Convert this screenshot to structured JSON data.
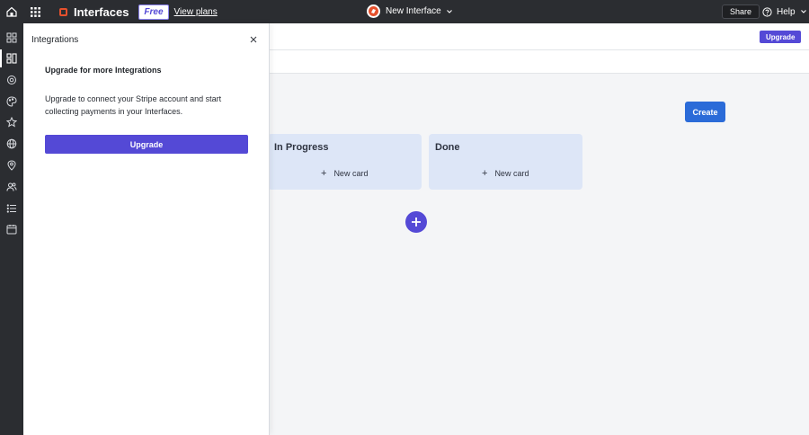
{
  "topbar": {
    "app_name": "Interfaces",
    "badge": "Free",
    "view_plans": "View plans",
    "interface_title": "New Interface",
    "share": "Share",
    "help": "Help"
  },
  "subheader": {
    "upgrade": "Upgrade"
  },
  "board": {
    "create": "Create",
    "columns": [
      {
        "title": "In Progress",
        "new_card": "New card"
      },
      {
        "title": "Done",
        "new_card": "New card"
      }
    ]
  },
  "panel": {
    "title": "Integrations",
    "heading": "Upgrade for more Integrations",
    "body": "Upgrade to connect your Stripe account and start collecting payments in your Interfaces.",
    "upgrade": "Upgrade"
  },
  "rail": {
    "icons": [
      "interfaces-icon",
      "pages-icon",
      "layers-icon",
      "palette-icon",
      "star-icon",
      "globe-icon",
      "location-icon",
      "users-icon",
      "list-icon",
      "calendar-icon"
    ]
  },
  "colors": {
    "accent": "#5449d6",
    "brand": "#e6512d",
    "create": "#2b6bd8",
    "dark": "#2b2d31",
    "column": "#dde6f7"
  }
}
